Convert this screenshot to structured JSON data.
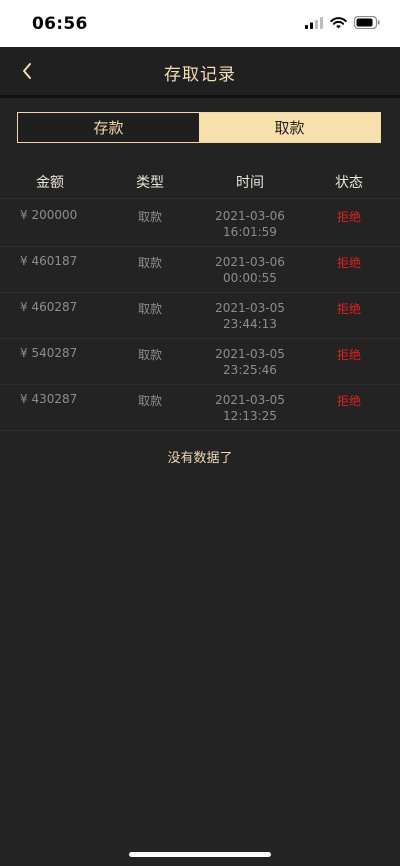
{
  "status_bar": {
    "time": "06:56"
  },
  "header": {
    "title": "存取记录"
  },
  "tabs": [
    {
      "label": "存款",
      "active": false
    },
    {
      "label": "取款",
      "active": true
    }
  ],
  "table": {
    "columns": [
      "金额",
      "类型",
      "时间",
      "状态"
    ],
    "rows": [
      {
        "amount": "¥ 200000",
        "type": "取款",
        "date": "2021-03-06",
        "clock": "16:01:59",
        "status": "拒绝"
      },
      {
        "amount": "¥ 460187",
        "type": "取款",
        "date": "2021-03-06",
        "clock": "00:00:55",
        "status": "拒绝"
      },
      {
        "amount": "¥ 460287",
        "type": "取款",
        "date": "2021-03-05",
        "clock": "23:44:13",
        "status": "拒绝"
      },
      {
        "amount": "¥ 540287",
        "type": "取款",
        "date": "2021-03-05",
        "clock": "23:25:46",
        "status": "拒绝"
      },
      {
        "amount": "¥ 430287",
        "type": "取款",
        "date": "2021-03-05",
        "clock": "12:13:25",
        "status": "拒绝"
      }
    ]
  },
  "footer_message": "没有数据了",
  "colors": {
    "accent": "#f6e0ab",
    "background": "#232323",
    "status_rejected": "#e0211b"
  },
  "icons": [
    "signal-icon",
    "wifi-icon",
    "battery-icon",
    "back-arrow-icon"
  ]
}
